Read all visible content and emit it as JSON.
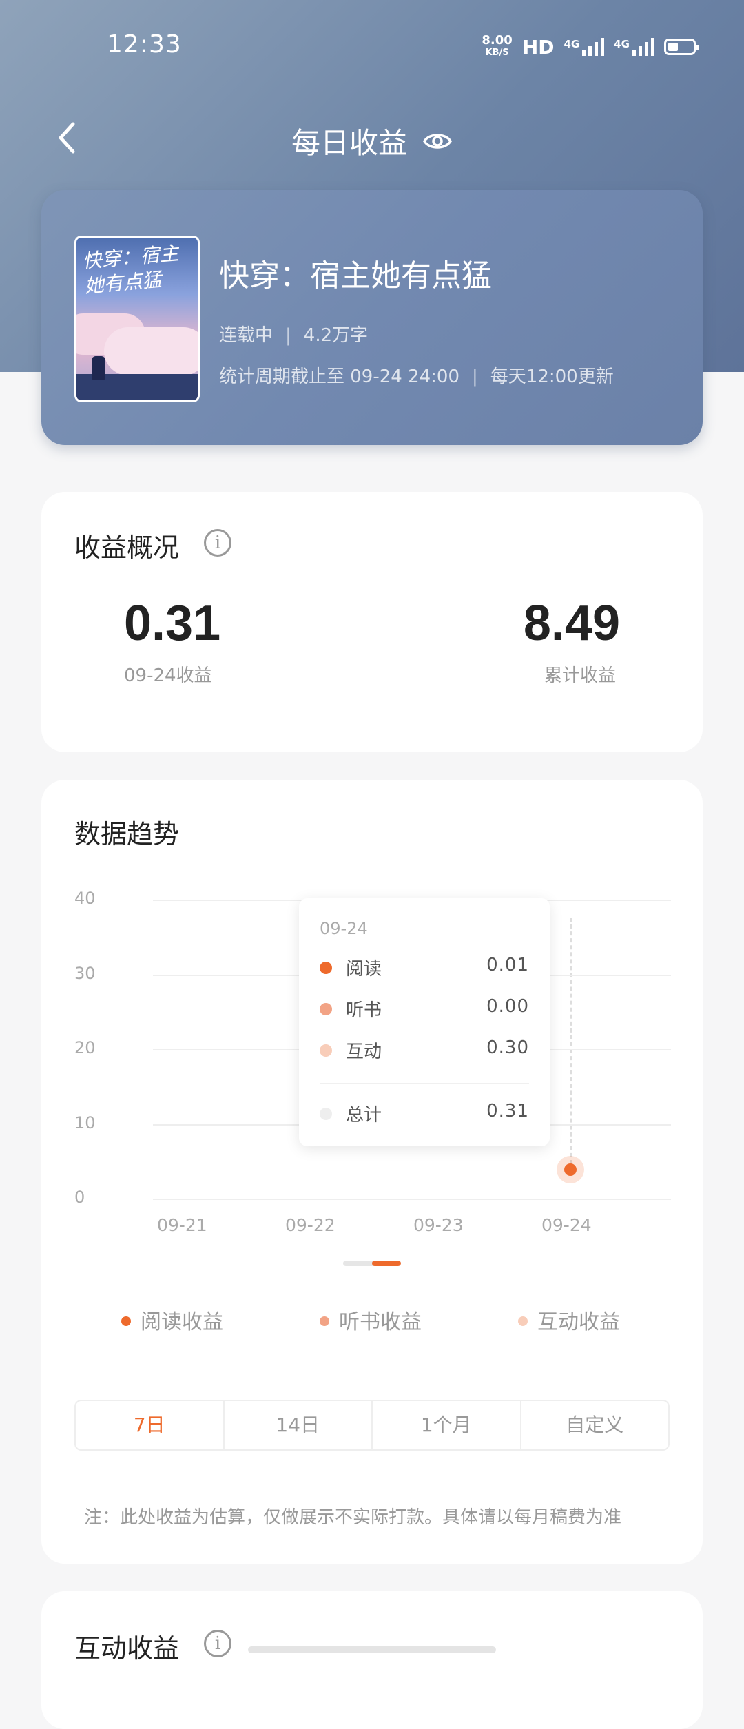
{
  "status_bar": {
    "time": "12:33",
    "speed_value": "8.00",
    "speed_unit": "KB/S",
    "hd": "HD",
    "net1": "4G",
    "net2": "4G"
  },
  "nav": {
    "title": "每日收益"
  },
  "book": {
    "cover_title": "快穿：宿主她有点猛",
    "title": "快穿：宿主她有点猛",
    "status": "连载中",
    "words": "4.2万字",
    "period": "统计周期截止至 09-24 24:00",
    "update": "每天12:00更新"
  },
  "overview": {
    "title": "收益概况",
    "info": "i",
    "today_value": "0.31",
    "today_label": "09-24收益",
    "total_value": "8.49",
    "total_label": "累计收益"
  },
  "trend": {
    "title": "数据趋势",
    "tooltip": {
      "date": "09-24",
      "rows": [
        {
          "label": "阅读",
          "value": "0.01",
          "color": "#ee6a2c"
        },
        {
          "label": "听书",
          "value": "0.00",
          "color": "#f2a385"
        },
        {
          "label": "互动",
          "value": "0.30",
          "color": "#f8cdb9"
        }
      ],
      "total_label": "总计",
      "total_value": "0.31"
    },
    "legend": [
      {
        "label": "阅读收益",
        "color": "#ee6a2c"
      },
      {
        "label": "听书收益",
        "color": "#f2a385"
      },
      {
        "label": "互动收益",
        "color": "#f8cdb9"
      }
    ],
    "ranges": [
      "7日",
      "14日",
      "1个月",
      "自定义"
    ],
    "active_range": "7日",
    "note": "注：此处收益为估算，仅做展示不实际打款。具体请以每月稿费为准"
  },
  "chart_data": {
    "type": "line",
    "x": [
      "09-21",
      "09-22",
      "09-23",
      "09-24"
    ],
    "ylim": [
      0,
      40
    ],
    "yticks": [
      "0",
      "10",
      "20",
      "30",
      "40"
    ],
    "series": [
      {
        "name": "阅读收益",
        "values": [
          null,
          null,
          null,
          0.01
        ]
      },
      {
        "name": "听书收益",
        "values": [
          null,
          null,
          null,
          0.0
        ]
      },
      {
        "name": "互动收益",
        "values": [
          null,
          null,
          null,
          0.3
        ]
      }
    ],
    "grid": true,
    "legend": "bottom"
  },
  "interaction": {
    "title": "互动收益",
    "info": "i"
  }
}
